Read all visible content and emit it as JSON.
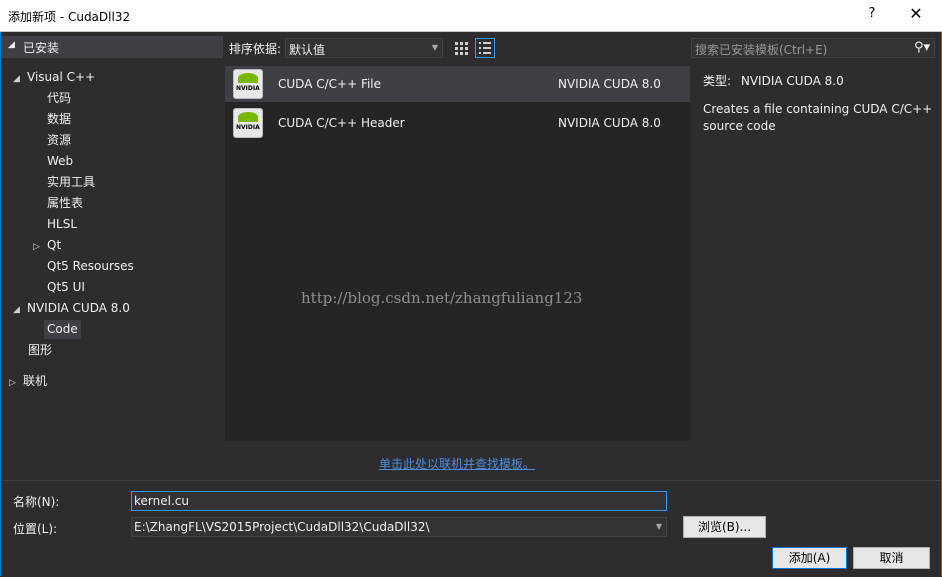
{
  "window": {
    "title": "添加新项 - CudaDll32",
    "help_label": "?",
    "close_label": "✕"
  },
  "tree": {
    "installed": "已安装",
    "items": [
      {
        "label": "Visual C++",
        "twisty": "◢"
      },
      {
        "label": "代码"
      },
      {
        "label": "数据"
      },
      {
        "label": "资源"
      },
      {
        "label": "Web"
      },
      {
        "label": "实用工具"
      },
      {
        "label": "属性表"
      },
      {
        "label": "HLSL"
      },
      {
        "label": "Qt",
        "twisty": "▷"
      },
      {
        "label": "Qt5 Resourses"
      },
      {
        "label": "Qt5 UI"
      },
      {
        "label": "NVIDIA CUDA 8.0",
        "twisty": "◢"
      },
      {
        "label": "Code"
      },
      {
        "label": "图形"
      },
      {
        "label": "联机",
        "twisty": "▷"
      }
    ]
  },
  "toolbar": {
    "sort_label": "排序依据:",
    "sort_value": "默认值",
    "search_placeholder": "搜索已安装模板(Ctrl+E)"
  },
  "templates": [
    {
      "name": "CUDA C/C++ File",
      "source": "NVIDIA CUDA 8.0"
    },
    {
      "name": "CUDA C/C++ Header",
      "source": "NVIDIA CUDA 8.0"
    }
  ],
  "details": {
    "type_label": "类型:",
    "type_value": "NVIDIA CUDA 8.0",
    "description": "Creates a file containing CUDA C/C++ source code"
  },
  "watermark": "http://blog.csdn.net/zhangfuliang123",
  "online_link": "单击此处以联机并查找模板。",
  "form": {
    "name_label": "名称(N):",
    "name_value": "kernel.cu",
    "location_label": "位置(L):",
    "location_value": "E:\\ZhangFL\\VS2015Project\\CudaDll32\\CudaDll32\\",
    "browse_label": "浏览(B)...",
    "add_label": "添加(A)",
    "cancel_label": "取消"
  },
  "colors": {
    "accent": "#007acc",
    "link": "#4f8edc",
    "nvidia_green": "#76b900"
  }
}
